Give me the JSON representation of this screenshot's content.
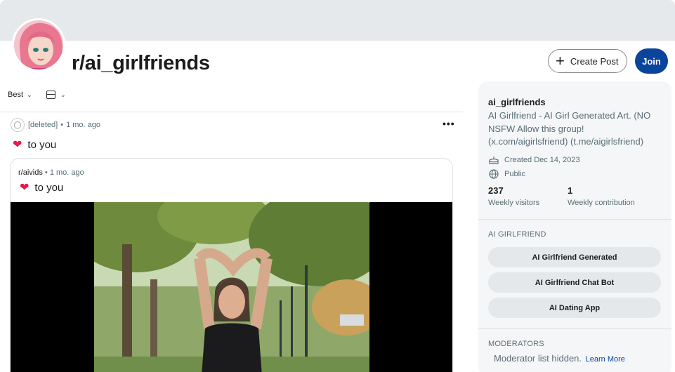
{
  "header": {
    "subreddit_title": "r/ai_girlfriends",
    "create_post_label": "Create Post",
    "join_label": "Join"
  },
  "feed": {
    "sort_label": "Best",
    "post": {
      "author": "[deleted]",
      "age": "1 mo. ago",
      "title": "to you",
      "crosspost": {
        "subreddit": "r/aivids",
        "age": "1 mo. ago",
        "title": "to you"
      }
    }
  },
  "sidebar": {
    "name": "ai_girlfriends",
    "description": "AI Girlfriend - AI Girl Generated Art. (NO NSFW Allow this group! (x.com/aigirlsfriend) (t.me/aigirlsfriend)",
    "created": "Created Dec 14, 2023",
    "visibility": "Public",
    "stats": [
      {
        "value": "237",
        "label": "Weekly visitors"
      },
      {
        "value": "1",
        "label": "Weekly contribution"
      }
    ],
    "section_title": "AI GIRLFRIEND",
    "links": [
      "AI Girlfriend Generated",
      "AI Girlfriend Chat Bot",
      "AI Dating App"
    ],
    "moderators_title": "MODERATORS",
    "moderators_hidden": "Moderator list hidden.",
    "learn_more": "Learn More"
  },
  "icons": {
    "more": "more-horizontal-icon",
    "plus": "plus-icon",
    "cake": "cake-icon",
    "globe": "globe-icon",
    "layout": "card-layout-icon",
    "chevron": "chevron-down-icon"
  },
  "colors": {
    "join": "#0a449b",
    "heart": "#e8194a",
    "link": "#0a449b"
  }
}
